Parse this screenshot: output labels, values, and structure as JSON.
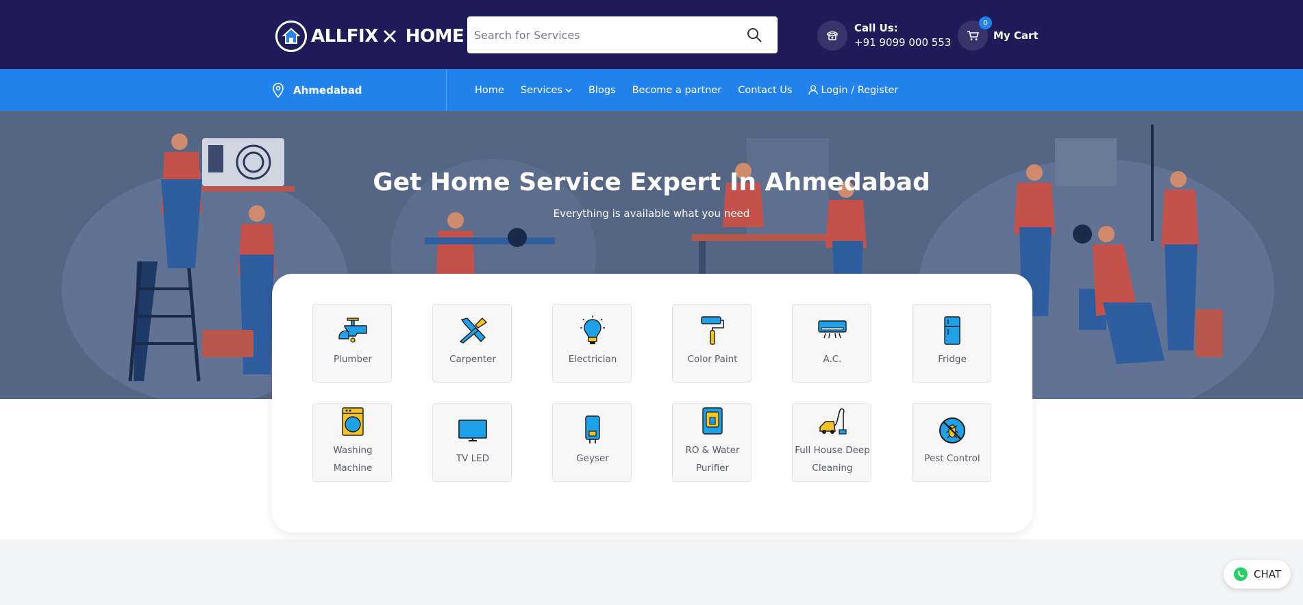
{
  "header": {
    "logo_text_1": "ALLFIX",
    "logo_text_2": "HOME",
    "search_placeholder": "Search for Services",
    "call_label": "Call Us:",
    "call_number": "+91 9099 000 553",
    "cart_label": "My Cart",
    "cart_count": "0"
  },
  "navbar": {
    "location": "Ahmedabad",
    "items": [
      {
        "label": "Home"
      },
      {
        "label": "Services"
      },
      {
        "label": "Blogs"
      },
      {
        "label": "Become a partner"
      },
      {
        "label": "Contact Us"
      },
      {
        "label": "Login / Register"
      }
    ]
  },
  "hero": {
    "title": "Get Home Service Expert In Ahmedabad",
    "subtitle": "Everything is available what you need"
  },
  "services": {
    "row1": [
      {
        "label": "Plumber",
        "icon": "tap-icon"
      },
      {
        "label": "Carpenter",
        "icon": "tools-icon"
      },
      {
        "label": "Electrician",
        "icon": "bulb-icon"
      },
      {
        "label": "Color Paint",
        "icon": "paint-roller-icon"
      },
      {
        "label": "A.C.",
        "icon": "ac-icon"
      },
      {
        "label": "Fridge",
        "icon": "fridge-icon"
      }
    ],
    "row2": [
      {
        "label1": "Washing",
        "label2": "Machine",
        "icon": "washing-machine-icon"
      },
      {
        "label": "TV LED",
        "icon": "tv-icon"
      },
      {
        "label": "Geyser",
        "icon": "geyser-icon"
      },
      {
        "label1": "RO & Water",
        "label2": "Purifier",
        "icon": "water-purifier-icon"
      },
      {
        "label1": "Full House Deep",
        "label2": "Cleaning",
        "icon": "vacuum-icon"
      },
      {
        "label": "Pest Control",
        "icon": "pest-icon"
      }
    ]
  },
  "chat": {
    "label": "CHAT"
  },
  "colors": {
    "header_bg": "#1f1c59",
    "nav_bg": "#2383ed",
    "hero_bg": "#556584",
    "icon_blue": "#1ea1e9",
    "icon_yellow": "#f6c323"
  }
}
